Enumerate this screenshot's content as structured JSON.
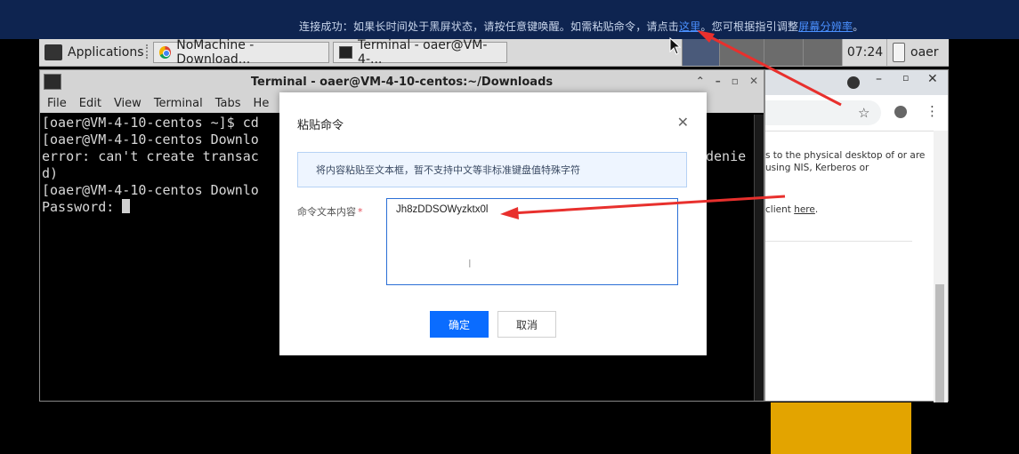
{
  "banner": {
    "text_before": "连接成功：如果长时间处于黑屏状态，请按任意键唤醒。如需粘贴命令，请点击",
    "link1": "这里",
    "text_middle": "。您可根据指引调整",
    "link2": "屏幕分辨率",
    "text_after": "。"
  },
  "taskbar": {
    "applications": "Applications",
    "tab_chrome": "NoMachine - Download...",
    "tab_terminal": "Terminal - oaer@VM-4-...",
    "clock": "07:24",
    "user": "oaer"
  },
  "terminal": {
    "title": "Terminal - oaer@VM-4-10-centos:~/Downloads",
    "menu": [
      "File",
      "Edit",
      "View",
      "Terminal",
      "Tabs",
      "He"
    ],
    "lines": [
      "[oaer@VM-4-10-centos ~]$ cd",
      "[oaer@VM-4-10-centos Downlo",
      "error: can't create transac",
      "d)",
      "[oaer@VM-4-10-centos Downlo",
      "Password: "
    ],
    "right_fragment": "denie"
  },
  "chrome": {
    "para1": "s to the physical desktop of or are using NIS, Kerberos or",
    "para2_prefix": "client ",
    "para2_link": "here",
    "para2_suffix": "."
  },
  "dialog": {
    "title": "粘贴命令",
    "info": "将内容粘贴至文本框，暂不支持中文等非标准键盘值特殊字符",
    "label": "命令文本内容",
    "required_mark": "*",
    "input_value": "Jh8zDDSOWyzktx0l",
    "ok": "确定",
    "cancel": "取消"
  },
  "colors": {
    "banner_bg": "#0e2450",
    "primary": "#0a6cff",
    "arrow": "#e8302d"
  }
}
